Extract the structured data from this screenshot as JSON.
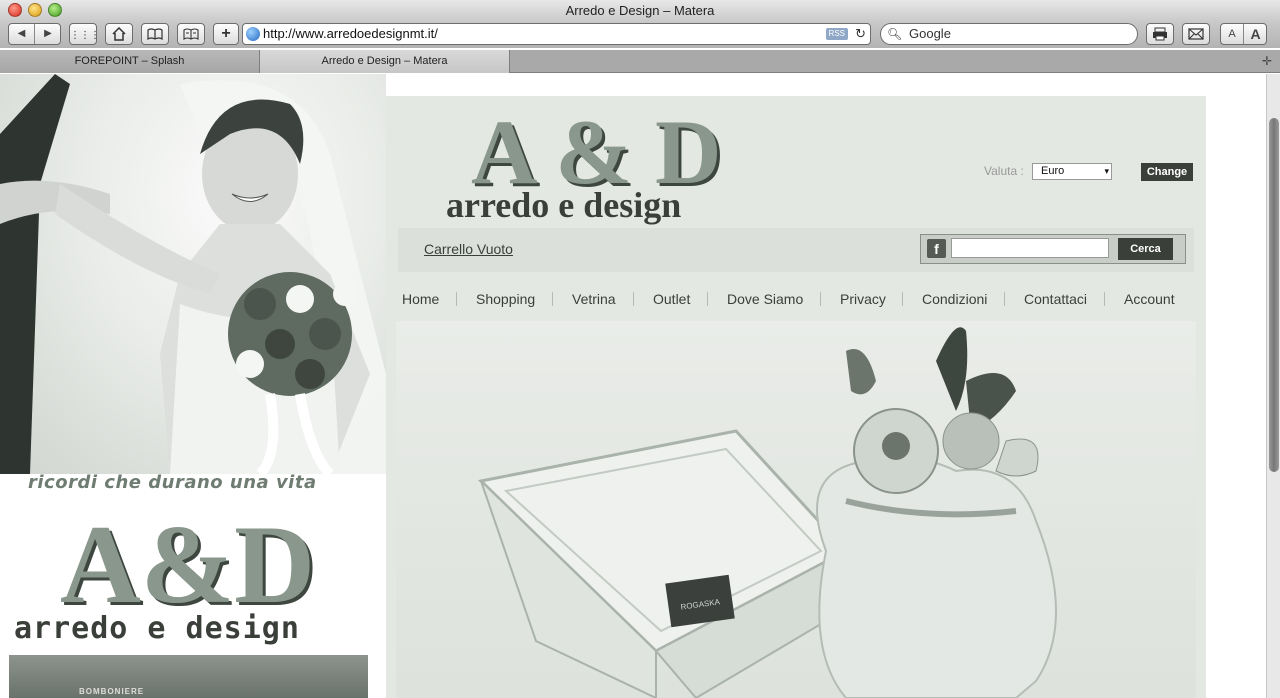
{
  "window": {
    "title": "Arredo e Design – Matera"
  },
  "toolbar": {
    "url": "http://www.arredoedesignmt.it/",
    "rss": "RSS",
    "search_placeholder": "Google"
  },
  "tabs": [
    {
      "label": "FOREPOINT – Splash"
    },
    {
      "label": "Arredo e Design – Matera"
    }
  ],
  "site": {
    "tagline": "ricordi che durano una vita",
    "logo_big": "A & D",
    "logo_big_left": "A&D",
    "logo_small": "arredo e design",
    "store_sign": "BOMBONIERE",
    "currency": {
      "label": "Valuta :",
      "selected": "Euro",
      "button": "Change"
    },
    "cart": {
      "label": "Carrello Vuoto"
    },
    "search": {
      "button": "Cerca",
      "fb": "f"
    },
    "nav": [
      "Home",
      "Shopping",
      "Vetrina",
      "Outlet",
      "Dove Siamo",
      "Privacy",
      "Condizioni",
      "Contattaci",
      "Account"
    ],
    "hero_badge": "ROGASKA"
  }
}
